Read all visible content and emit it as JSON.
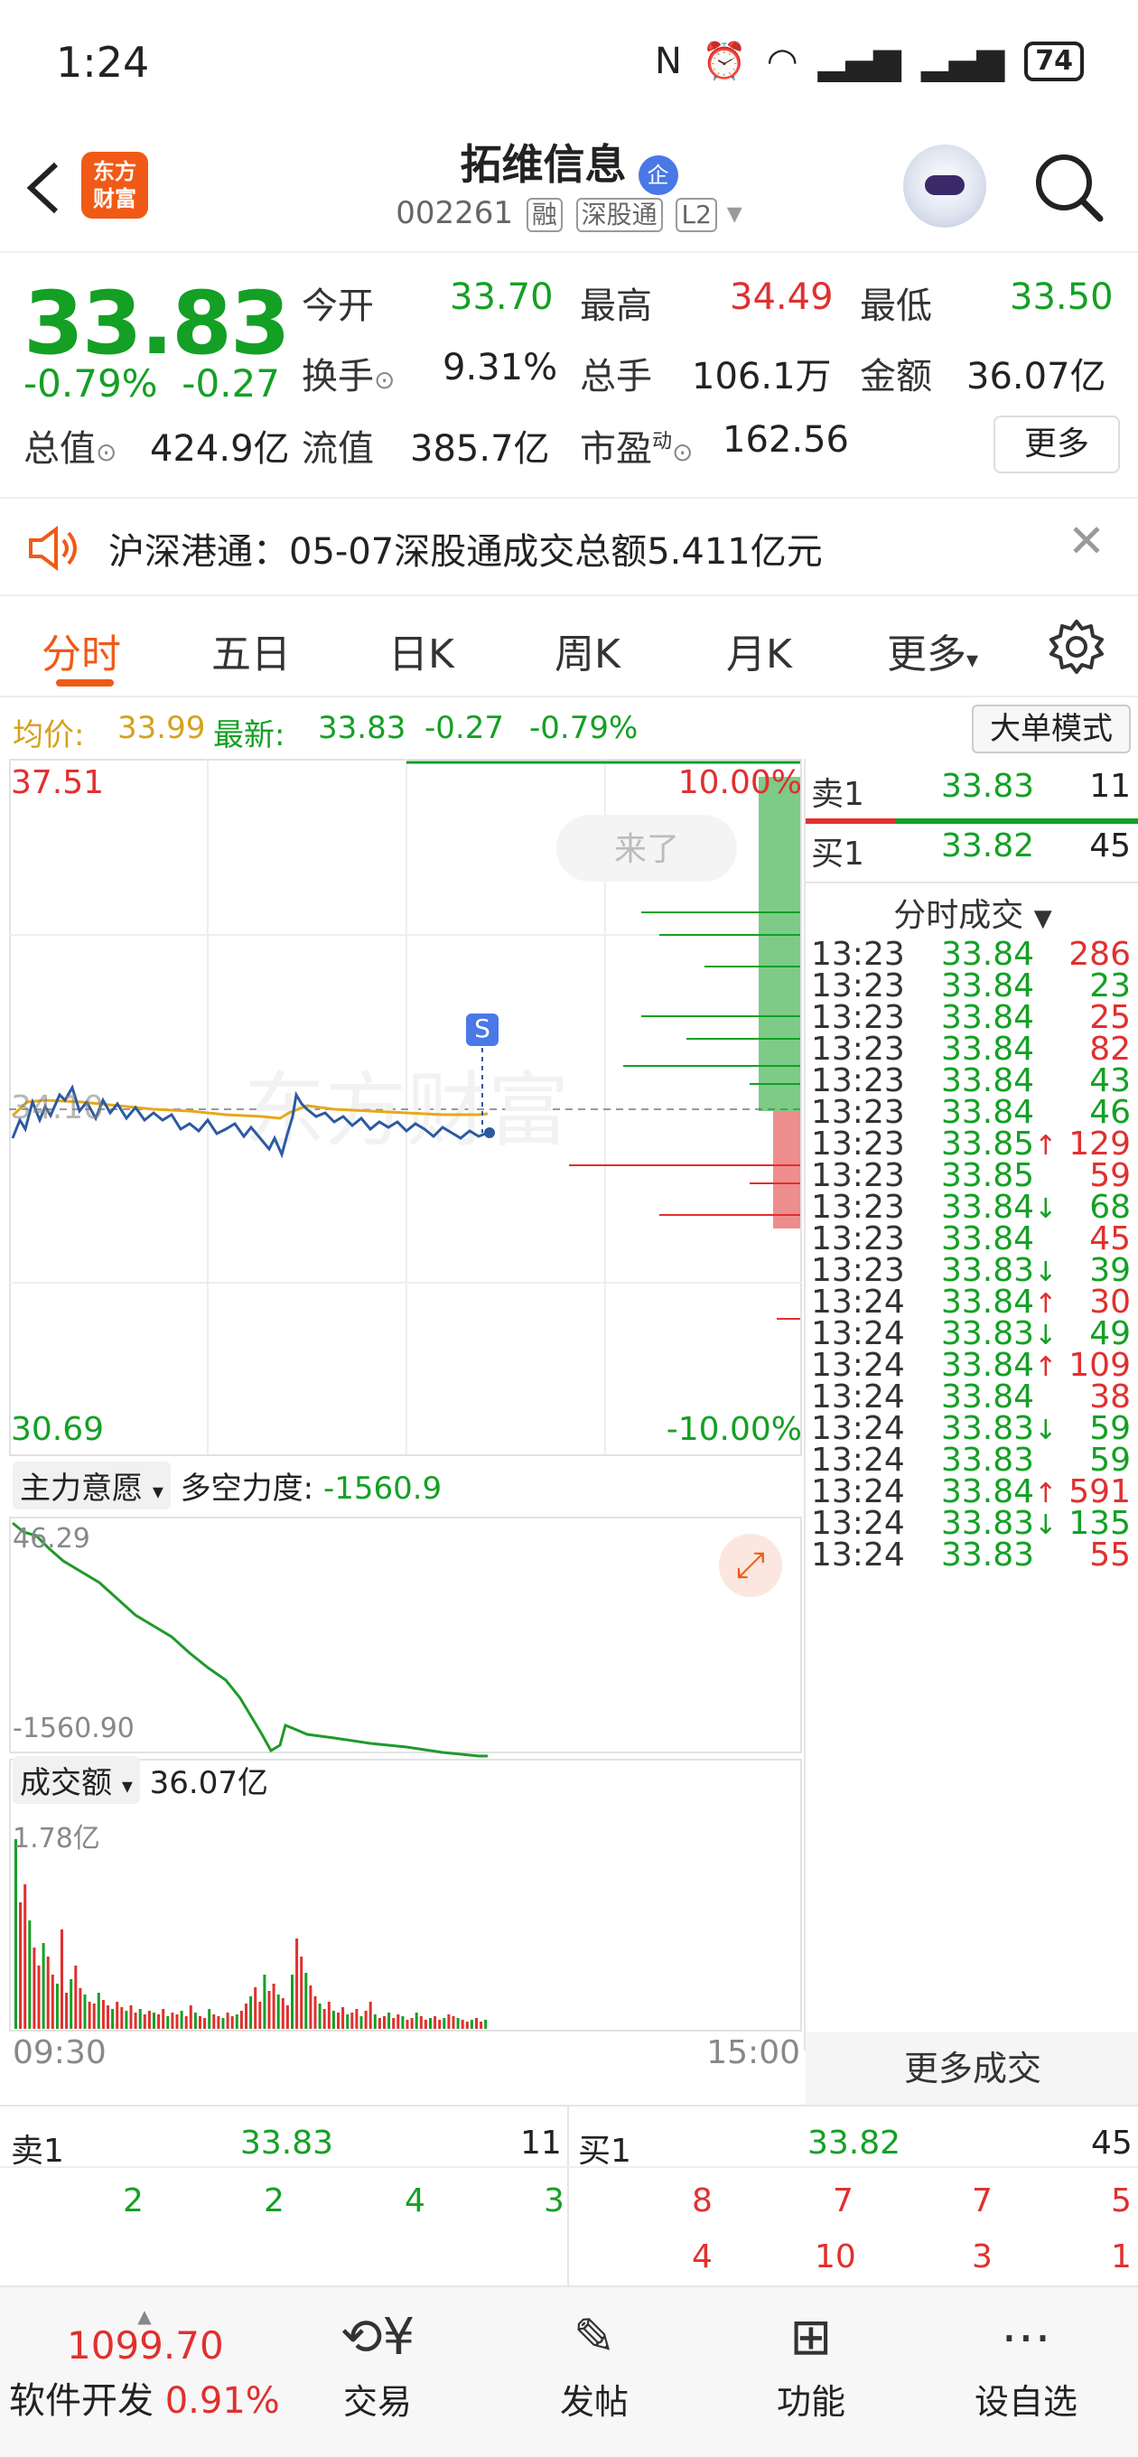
{
  "status_bar": {
    "time": "1:24",
    "battery": "74"
  },
  "header": {
    "logo_line1": "东方",
    "logo_line2": "财富",
    "title": "拓维信息",
    "title_badge": "企",
    "code": "002261",
    "tags": [
      "融",
      "深股通",
      "L2"
    ]
  },
  "quote": {
    "price": "33.83",
    "change_pct": "-0.79%",
    "change": "-0.27",
    "open_label": "今开",
    "open": "33.70",
    "high_label": "最高",
    "high": "34.49",
    "low_label": "最低",
    "low": "33.50",
    "turnover_label": "换手",
    "turnover": "9.31%",
    "volume_label": "总手",
    "volume": "106.1万",
    "amount_label": "金额",
    "amount": "36.07亿",
    "mktcap_label": "总值",
    "mktcap": "424.9亿",
    "float_label": "流值",
    "float": "385.7亿",
    "pe_label": "市盈",
    "pe_sup": "动",
    "pe": "162.56",
    "more": "更多"
  },
  "notice": {
    "text": "沪深港通：05-07深股通成交总额5.411亿元"
  },
  "tabs": [
    "分时",
    "五日",
    "日K",
    "周K",
    "月K",
    "更多"
  ],
  "avg_row": {
    "avg_label": "均价:",
    "avg": "33.99",
    "latest_label": "最新:",
    "latest": "33.83",
    "chg": "-0.27",
    "pct": "-0.79%",
    "big_order_mode": "大单模式"
  },
  "price_chart": {
    "top_price": "37.51",
    "top_pct": "10.00%",
    "bottom_price": "30.69",
    "bottom_pct": "-10.00%",
    "mid_label": "34.10",
    "pill": "来了",
    "s_marker": "S",
    "watermark": "东方财富"
  },
  "force_panel": {
    "dropdown": "主力意愿",
    "label": "多空力度:",
    "value": "-1560.9",
    "top": "46.29",
    "bottom": "-1560.90"
  },
  "volume_panel": {
    "dropdown": "成交额",
    "value": "36.07亿",
    "max": "1.78亿",
    "time_start": "09:30",
    "time_end": "15:00"
  },
  "side": {
    "sell1_label": "卖1",
    "sell1_price": "33.83",
    "sell1_vol": "11",
    "buy1_label": "买1",
    "buy1_price": "33.82",
    "buy1_vol": "45",
    "ticks_header": "分时成交",
    "ticks": [
      {
        "t": "13:23",
        "p": "33.84",
        "arrow": "",
        "v": "286",
        "vc": "red"
      },
      {
        "t": "13:23",
        "p": "33.84",
        "arrow": "",
        "v": "23",
        "vc": "green"
      },
      {
        "t": "13:23",
        "p": "33.84",
        "arrow": "",
        "v": "25",
        "vc": "red"
      },
      {
        "t": "13:23",
        "p": "33.84",
        "arrow": "",
        "v": "82",
        "vc": "red"
      },
      {
        "t": "13:23",
        "p": "33.84",
        "arrow": "",
        "v": "43",
        "vc": "green"
      },
      {
        "t": "13:23",
        "p": "33.84",
        "arrow": "",
        "v": "46",
        "vc": "green"
      },
      {
        "t": "13:23",
        "p": "33.85",
        "arrow": "↑",
        "v": "129",
        "vc": "red"
      },
      {
        "t": "13:23",
        "p": "33.85",
        "arrow": "",
        "v": "59",
        "vc": "red"
      },
      {
        "t": "13:23",
        "p": "33.84",
        "arrow": "↓",
        "v": "68",
        "vc": "green"
      },
      {
        "t": "13:23",
        "p": "33.84",
        "arrow": "",
        "v": "45",
        "vc": "red"
      },
      {
        "t": "13:23",
        "p": "33.83",
        "arrow": "↓",
        "v": "39",
        "vc": "green"
      },
      {
        "t": "13:24",
        "p": "33.84",
        "arrow": "↑",
        "v": "30",
        "vc": "red"
      },
      {
        "t": "13:24",
        "p": "33.83",
        "arrow": "↓",
        "v": "49",
        "vc": "green"
      },
      {
        "t": "13:24",
        "p": "33.84",
        "arrow": "↑",
        "v": "109",
        "vc": "red"
      },
      {
        "t": "13:24",
        "p": "33.84",
        "arrow": "",
        "v": "38",
        "vc": "red"
      },
      {
        "t": "13:24",
        "p": "33.83",
        "arrow": "↓",
        "v": "59",
        "vc": "green"
      },
      {
        "t": "13:24",
        "p": "33.83",
        "arrow": "",
        "v": "59",
        "vc": "green"
      },
      {
        "t": "13:24",
        "p": "33.84",
        "arrow": "↑",
        "v": "591",
        "vc": "red"
      },
      {
        "t": "13:24",
        "p": "33.83",
        "arrow": "↓",
        "v": "135",
        "vc": "green"
      },
      {
        "t": "13:24",
        "p": "33.83",
        "arrow": "",
        "v": "55",
        "vc": "red"
      }
    ],
    "more_trades": "更多成交"
  },
  "book": {
    "sell_label": "卖1",
    "sell_price": "33.83",
    "sell_vol": "11",
    "buy_label": "买1",
    "buy_price": "33.82",
    "buy_vol": "45",
    "sell_queue": [
      "2",
      "2",
      "4",
      "3"
    ],
    "buy_queue_row1": [
      "8",
      "7",
      "7",
      "5"
    ],
    "buy_queue_row2": [
      "4",
      "10",
      "3",
      "1"
    ]
  },
  "nav": {
    "index_value": "1099.70",
    "index_name": "软件开发",
    "index_pct": "0.91%",
    "items": [
      "交易",
      "发帖",
      "功能",
      "设自选"
    ]
  },
  "colors": {
    "red": "#e0302f",
    "green": "#14a024",
    "gold": "#d6a21d",
    "accent": "#f05a16"
  }
}
